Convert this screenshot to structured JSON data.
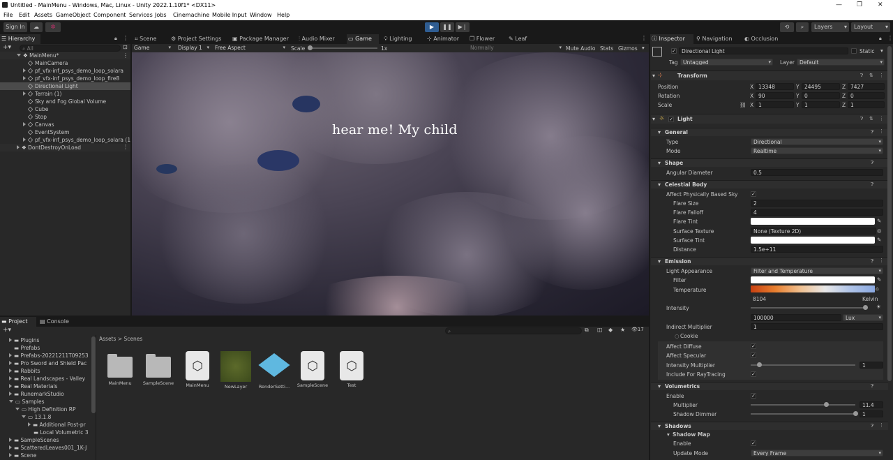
{
  "window": {
    "title": "Untitled - MainMenu - Windows, Mac, Linux - Unity 2022.1.10f1* <DX11>"
  },
  "menu": [
    "File",
    "Edit",
    "Assets",
    "GameObject",
    "Component",
    "Services",
    "Jobs",
    "Cinemachine",
    "Mobile Input",
    "Window",
    "Help"
  ],
  "toolbar": {
    "signin": "Sign In",
    "layers": "Layers",
    "layout": "Layout"
  },
  "hierarchy": {
    "tab": "Hierarchy",
    "search_placeholder": "All",
    "items": [
      "MainMenu*",
      "MainCamera",
      "pf_vfx-inf_psys_demo_loop_solara",
      "pf_vfx-inf_psys_demo_loop_fire8",
      "Directional Light",
      "Terrain (1)",
      "Sky and Fog Global Volume",
      "Cube",
      "Stop",
      "Canvas",
      "EventSystem",
      "pf_vfx-inf_psys_demo_loop_solara (1",
      "DontDestroyOnLoad"
    ]
  },
  "center_tabs": [
    "Scene",
    "Project Settings",
    "Package Manager",
    "Audio Mixer",
    "Game",
    "Lighting",
    "Animator",
    "Flower",
    "Leaf"
  ],
  "game_toolbar": {
    "mode": "Game",
    "display": "Display 1",
    "aspect": "Free Aspect",
    "scale_label": "Scale",
    "scale_value": "1x",
    "play_focus": "Normally",
    "mute": "Mute Audio",
    "stats": "Stats",
    "gizmos": "Gizmos"
  },
  "game_view": {
    "caption": "hear me! My child"
  },
  "project": {
    "tabs": [
      "Project",
      "Console"
    ],
    "count": "17",
    "breadcrumb": [
      "Assets",
      ">",
      "Scenes"
    ],
    "tree": [
      "Plugins",
      "Prefabs",
      "Prefabs-20221211T09253",
      "Pro Sword and Shield Pac",
      "Rabbits",
      "Real Landscapes - Valley",
      "Real Materials",
      "RunemarkStudio",
      "Samples",
      "High Definition RP",
      "13.1.8",
      "Additional Post-pr",
      "Local Volumetric 3",
      "SampleScenes",
      "ScatteredLeaves001_1K-J",
      "Scene"
    ],
    "assets": [
      "MainMenu",
      "SampleScene",
      "MainMenu",
      "NewLayer",
      "RenderSetti...",
      "SampleScene",
      "Test"
    ]
  },
  "inspector": {
    "tabs": [
      "Inspector",
      "Navigation",
      "Occlusion"
    ],
    "object_name": "Directional Light",
    "static_label": "Static",
    "tag_label": "Tag",
    "tag_value": "Untagged",
    "layer_label": "Layer",
    "layer_value": "Default",
    "transform": {
      "title": "Transform",
      "position": [
        "13348",
        "24495",
        "7427"
      ],
      "rotation": [
        "90",
        "0",
        "0"
      ],
      "scale": [
        "1",
        "1",
        "1"
      ],
      "pos_label": "Position",
      "rot_label": "Rotation",
      "scale_label": "Scale"
    },
    "light_title": "Light",
    "general": {
      "title": "General",
      "type_label": "Type",
      "type": "Directional",
      "mode_label": "Mode",
      "mode": "Realtime"
    },
    "shape": {
      "title": "Shape",
      "angular_label": "Angular Diameter",
      "angular": "0.5"
    },
    "celestial": {
      "title": "Celestial Body",
      "affect_label": "Affect Physically Based Sky",
      "flare_size_label": "Flare Size",
      "flare_size": "2",
      "flare_falloff_label": "Flare Falloff",
      "flare_falloff": "4",
      "flare_tint_label": "Flare Tint",
      "surface_texture_label": "Surface Texture",
      "surface_texture": "None (Texture 2D)",
      "surface_tint_label": "Surface Tint",
      "distance_label": "Distance",
      "distance": "1.5e+11"
    },
    "emission": {
      "title": "Emission",
      "appearance_label": "Light Appearance",
      "appearance": "Filter and Temperature",
      "filter_label": "Filter",
      "temperature_label": "Temperature",
      "temperature": "8104",
      "kelvin": "Kelvin",
      "intensity_label": "Intensity",
      "intensity": "100000",
      "intensity_unit": "Lux",
      "indirect_label": "Indirect Multiplier",
      "indirect": "1",
      "cookie_label": "Cookie",
      "affect_diffuse": "Affect Diffuse",
      "affect_specular": "Affect Specular",
      "intensity_mult_label": "Intensity Multiplier",
      "intensity_mult": "1",
      "raytracing_label": "Include For RayTracing"
    },
    "volumetrics": {
      "title": "Volumetrics",
      "enable_label": "Enable",
      "multiplier_label": "Multiplier",
      "multiplier": "11.4",
      "shadow_dimmer_label": "Shadow Dimmer",
      "shadow_dimmer": "1"
    },
    "shadows": {
      "title": "Shadows",
      "shadow_map": "Shadow Map",
      "enable_label": "Enable",
      "update_label": "Update Mode",
      "update": "Every Frame"
    }
  }
}
